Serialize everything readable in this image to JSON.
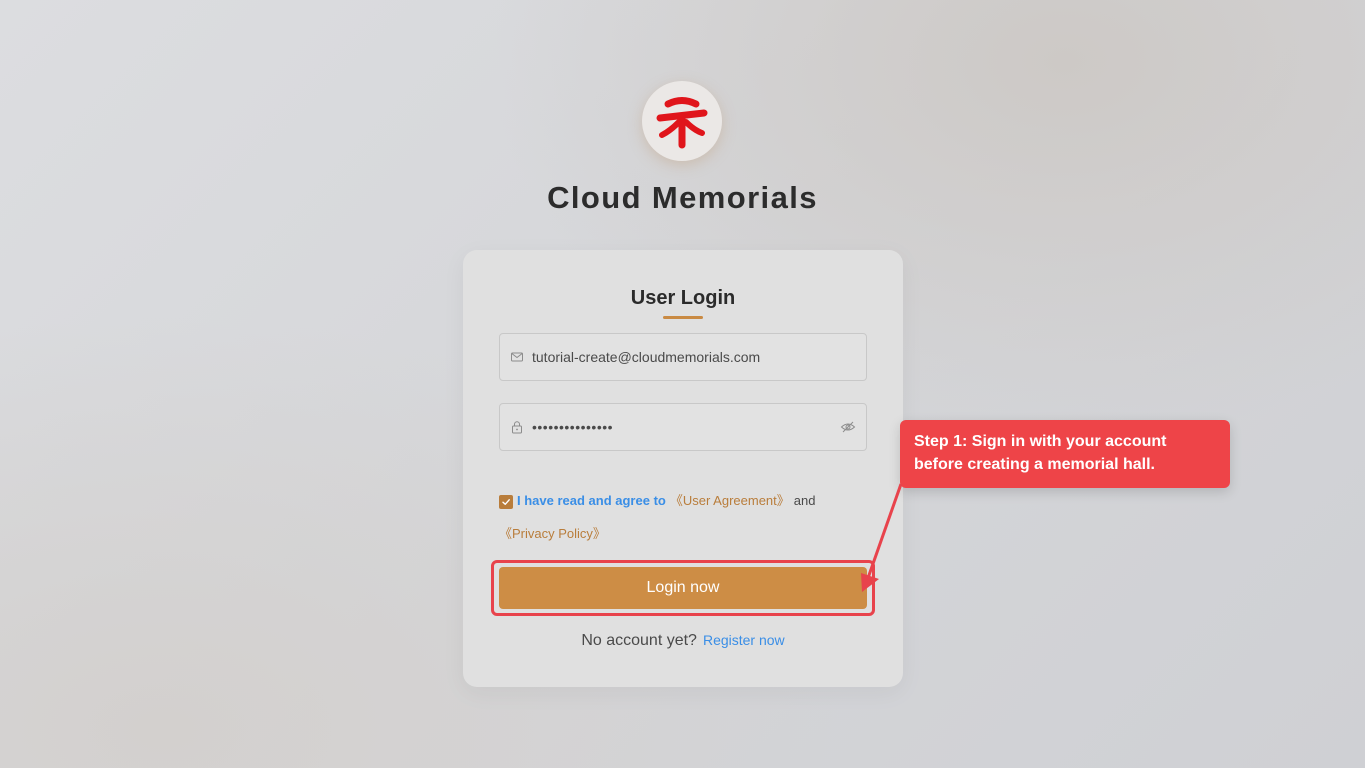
{
  "brand": {
    "name": "Cloud Memorials",
    "logo_icon": "red-calligraphy-logo-icon",
    "logo_color": "#e0151b"
  },
  "login_form": {
    "title": "User Login",
    "email": {
      "icon": "mail-icon",
      "value": "tutorial-create@cloudmemorials.com"
    },
    "password": {
      "icon": "lock-icon",
      "value": "•••••••••••••••",
      "toggle_icon": "eye-hidden-icon"
    },
    "agreement": {
      "checked": true,
      "text": "I have read and agree to",
      "user_agreement": "《User Agreement》",
      "and": "and",
      "privacy_policy": "《Privacy Policy》"
    },
    "login_button": "Login now",
    "no_account": "No account yet?",
    "register_link": "Register now"
  },
  "tutorial": {
    "callout_text": "Step 1: Sign in with your account before creating a memorial hall.",
    "highlight_color": "#e8434c",
    "callout_color": "#ee4448"
  },
  "colors": {
    "accent": "#cd8d45",
    "link": "#3a8ee6",
    "link_gold": "#b97d3b"
  }
}
